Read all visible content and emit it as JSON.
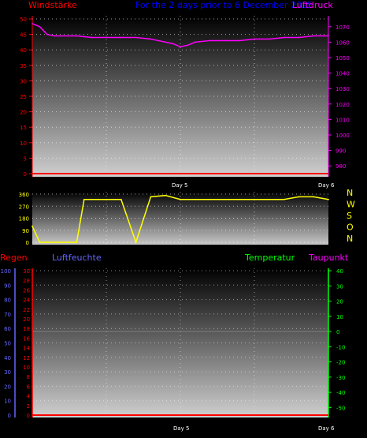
{
  "header": {
    "left_title": "Windstärke",
    "center_title": "For the 2 days prior to  6 December 2025",
    "right_title": "Luftdruck"
  },
  "bottom_header": {
    "regen": "Regen",
    "luftfeuchte": "Luftfeuchte",
    "temperatur": "Temperatur",
    "taupunkt": "Taupunkt"
  },
  "compass": [
    "N",
    "W",
    "S",
    "O",
    "N"
  ],
  "colors": {
    "wind": "#ff0000",
    "pressure": "#ff00ff",
    "direction": "#ffff00",
    "title": "#0000ff",
    "humidity": "#6666ff",
    "temperature": "#00ff00",
    "dewpoint": "#ff00ff",
    "rain": "#ff0000"
  },
  "chart_data": [
    {
      "type": "line",
      "name": "wind-pressure",
      "x_ticks": [
        "Day 5",
        "Day 6"
      ],
      "left_axis": {
        "series": "Windstärke",
        "ylim": [
          0,
          50
        ],
        "ticks": [
          0,
          5,
          10,
          15,
          20,
          25,
          30,
          35,
          40,
          45,
          50
        ]
      },
      "right_axis": {
        "series": "Luftdruck",
        "ylim": [
          975,
          1075
        ],
        "ticks": [
          980,
          990,
          1000,
          1010,
          1020,
          1030,
          1040,
          1050,
          1060,
          1070
        ]
      },
      "series": [
        {
          "name": "Windstärke",
          "x": [
            0,
            2
          ],
          "values": [
            0,
            0
          ]
        },
        {
          "name": "Luftdruck",
          "x": [
            0,
            0.05,
            0.1,
            0.15,
            0.2,
            0.3,
            0.4,
            0.5,
            0.6,
            0.7,
            0.8,
            0.85,
            0.9,
            0.95,
            1.0,
            1.05,
            1.1,
            1.2,
            1.3,
            1.4,
            1.5,
            1.6,
            1.7,
            1.8,
            1.9,
            2.0
          ],
          "values": [
            1072,
            1070,
            1065,
            1064,
            1064,
            1064,
            1063,
            1063,
            1063,
            1063,
            1062,
            1061,
            1060,
            1059,
            1057,
            1058,
            1060,
            1061,
            1061,
            1061,
            1062,
            1062,
            1063,
            1063,
            1064,
            1064
          ]
        }
      ]
    },
    {
      "type": "line",
      "name": "wind-direction",
      "ylim": [
        0,
        360
      ],
      "y_ticks": [
        0,
        90,
        180,
        270,
        360
      ],
      "series": [
        {
          "name": "direction",
          "x": [
            0,
            0.05,
            0.08,
            0.1,
            0.15,
            0.2,
            0.3,
            0.35,
            0.4,
            0.45,
            0.5,
            0.55,
            0.6,
            0.7,
            0.8,
            0.9,
            1.0,
            1.1,
            1.2,
            1.3,
            1.4,
            1.5,
            1.6,
            1.7,
            1.8,
            1.9,
            2.0
          ],
          "values": [
            120,
            0,
            0,
            0,
            0,
            0,
            0,
            320,
            320,
            320,
            320,
            320,
            320,
            0,
            340,
            350,
            320,
            320,
            320,
            320,
            320,
            320,
            320,
            320,
            340,
            340,
            320
          ]
        }
      ]
    },
    {
      "type": "line",
      "name": "rain-humidity-temperature",
      "x_ticks": [
        "Day 5",
        "Day 6"
      ],
      "axes": {
        "humidity_ticks": [
          0,
          10,
          20,
          30,
          40,
          50,
          60,
          70,
          80,
          90,
          100
        ],
        "rain_ticks": [
          0,
          2,
          4,
          6,
          8,
          10,
          12,
          14,
          16,
          18,
          20,
          22,
          24,
          26,
          28,
          30
        ],
        "temp_ticks": [
          -50,
          -40,
          -30,
          -20,
          -10,
          0,
          10,
          20,
          30,
          40
        ]
      },
      "series": [
        {
          "name": "Regen",
          "x": [
            0,
            2
          ],
          "values": [
            0,
            0
          ]
        }
      ]
    }
  ]
}
